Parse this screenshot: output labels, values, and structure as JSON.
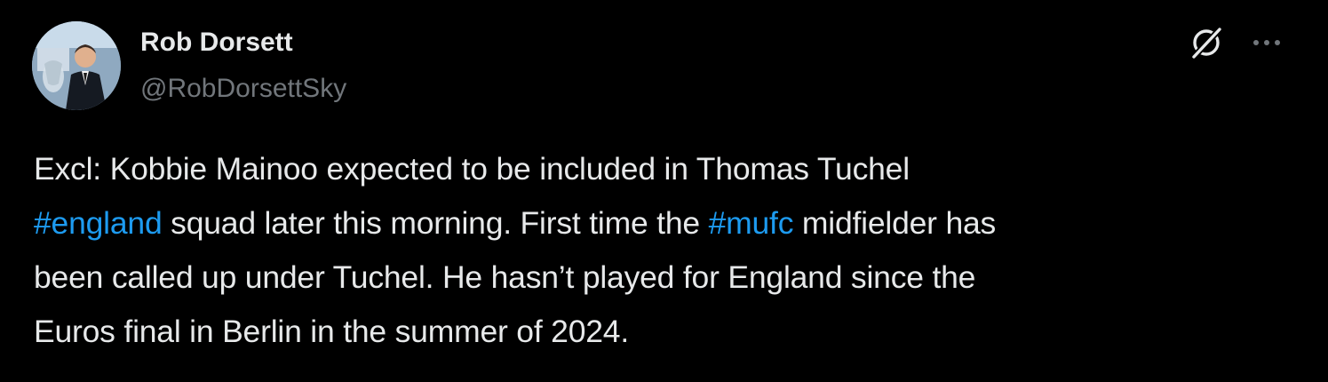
{
  "author": {
    "name": "Rob Dorsett",
    "handle": "@RobDorsettSky"
  },
  "actions": {
    "grok_icon": "grok-icon",
    "more_icon": "more-options-icon"
  },
  "tweet": {
    "line1": "Excl: Kobbie Mainoo expected to be included in Thomas Tuchel",
    "hashtag_england": "#england",
    "line2_mid": " squad later this morning. First time the ",
    "hashtag_mufc": "#mufc",
    "line2_end": " midfielder has",
    "line3": "been called up under Tuchel. He hasn’t played for England since the",
    "line4": "Euros final in Berlin in the summer of 2024."
  },
  "colors": {
    "background": "#000000",
    "text": "#e7e9ea",
    "secondary_text": "#71767b",
    "link": "#1d9bf0"
  }
}
